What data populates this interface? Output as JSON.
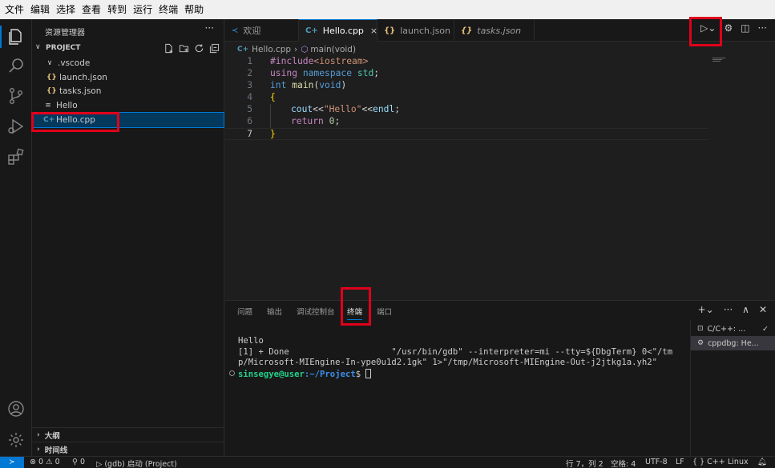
{
  "menu": [
    "文件",
    "编辑",
    "选择",
    "查看",
    "转到",
    "运行",
    "终端",
    "帮助"
  ],
  "sidebar": {
    "title": "资源管理器",
    "project_label": "PROJECT",
    "tree": [
      {
        "label": ".vscode",
        "kind": "folder"
      },
      {
        "label": "launch.json",
        "kind": "json"
      },
      {
        "label": "tasks.json",
        "kind": "json"
      },
      {
        "label": "Hello",
        "kind": "file"
      },
      {
        "label": "Hello.cpp",
        "kind": "cpp"
      }
    ],
    "outline_label": "大纲",
    "timeline_label": "时间线"
  },
  "tabs": [
    {
      "label": "欢迎",
      "icon": "vscode-icon"
    },
    {
      "label": "Hello.cpp",
      "icon": "cpp-icon",
      "active": true,
      "close": "×"
    },
    {
      "label": "launch.json",
      "icon": "json-icon"
    },
    {
      "label": "tasks.json",
      "icon": "json-icon"
    }
  ],
  "breadcrumb": {
    "file": "Hello.cpp",
    "symbol": "main(void)"
  },
  "code": {
    "line_numbers": [
      "1",
      "2",
      "3",
      "4",
      "5",
      "6",
      "7"
    ],
    "l1": {
      "pp": "#include",
      "inc": "<iostream>"
    },
    "l2": {
      "kw1": "using",
      "kw2": "namespace",
      "ns": "std",
      "semi": ";"
    },
    "l3": {
      "ty": "int",
      "fn": "main",
      "open": "(",
      "kw": "void",
      "close": ")"
    },
    "l4": {
      "br": "{"
    },
    "l5": {
      "id": "cout",
      "op1": "<<",
      "str": "\"Hello\"",
      "op2": "<<",
      "id2": "endl",
      "semi": ";"
    },
    "l6": {
      "kw": "return",
      "num": "0",
      "semi": ";"
    },
    "l7": {
      "br": "}"
    }
  },
  "panel": {
    "tabs": [
      "问题",
      "输出",
      "调试控制台",
      "终端",
      "端口"
    ],
    "active_tab": "终端",
    "terminal_lines": [
      "Hello",
      "[1] + Done                    \"/usr/bin/gdb\" --interpreter=mi --tty=${DbgTerm} 0<\"/tm",
      "p/Microsoft-MIEngine-In-ype0u1d2.1gk\" 1>\"/tmp/Microsoft-MIEngine-Out-j2jtkg1a.yh2\""
    ],
    "prompt_user": "sinsegye@user",
    "prompt_path": ":~/Project",
    "prompt_symbol": "$",
    "terminals": [
      {
        "label": "C/C++: ...",
        "icon": "terminal-icon",
        "status": "✓"
      },
      {
        "label": "cppdbg: He...",
        "icon": "debug-icon"
      }
    ]
  },
  "statusbar": {
    "remote": "≻",
    "errors": "0",
    "warnings": "0",
    "ports": "0",
    "debug": "(gdb) 启动 (Project)",
    "position": "行 7，列 2",
    "spaces": "空格: 4",
    "encoding": "UTF-8",
    "eol": "LF",
    "language": "C++",
    "platform": "Linux"
  },
  "colors": {
    "accent": "#0078d4",
    "highlight": "#e0001b"
  }
}
